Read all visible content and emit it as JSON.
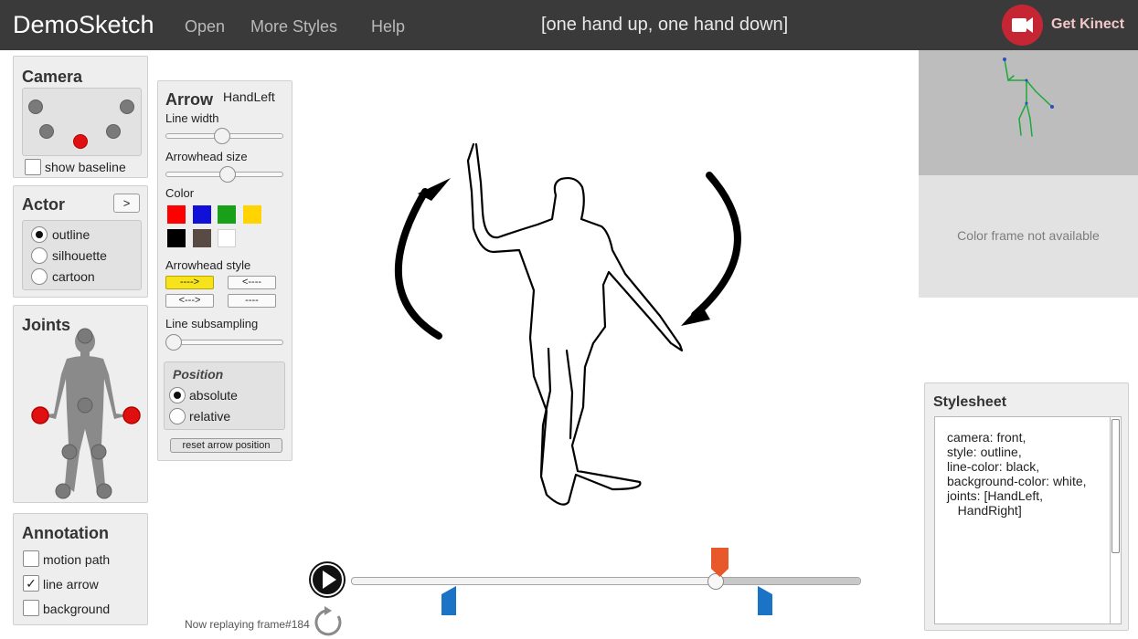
{
  "app": {
    "title": "DemoSketch"
  },
  "nav": {
    "open": "Open",
    "more_styles": "More Styles",
    "help": "Help"
  },
  "pose_label": "[one hand up, one hand down]",
  "kinect": {
    "label": "Get Kinect",
    "color": "#c62634"
  },
  "camera": {
    "title": "Camera",
    "baseline_label": "show baseline",
    "baseline_checked": false
  },
  "actor": {
    "title": "Actor",
    "expand_label": ">",
    "options": [
      "outline",
      "silhouette",
      "cartoon"
    ],
    "selected": "outline"
  },
  "joints": {
    "title": "Joints",
    "selected": [
      "HandLeft",
      "HandRight"
    ]
  },
  "annotation": {
    "title": "Annotation",
    "items": [
      {
        "label": "motion path",
        "checked": false,
        "mark": ""
      },
      {
        "label": "line arrow",
        "checked": true,
        "mark": "✓"
      },
      {
        "label": "background",
        "checked": false,
        "mark": ""
      }
    ]
  },
  "arrow_panel": {
    "title": "Arrow",
    "target": "HandLeft",
    "line_width_label": "Line width",
    "line_width_level": 0.48,
    "arrowhead_size_label": "Arrowhead size",
    "arrowhead_size_level": 0.53,
    "color_label": "Color",
    "colors": [
      "#ff0000",
      "#1010d8",
      "#18a018",
      "#ffd400",
      "#000000",
      "#5a4a44",
      "#ffffff"
    ],
    "arrowhead_style_label": "Arrowhead style",
    "styles": [
      "---->",
      "<----",
      "<--->",
      "----"
    ],
    "selected_style": "---->",
    "subsampling_label": "Line subsampling",
    "subsampling_level": 0.0,
    "position": {
      "title": "Position",
      "options": [
        "absolute",
        "relative"
      ],
      "selected": "absolute"
    },
    "reset_label": "reset arrow position"
  },
  "color_frame": {
    "message": "Color frame not available"
  },
  "stylesheet": {
    "title": "Stylesheet",
    "text": "camera: front,\nstyle: outline,\nline-color: black,\nbackground-color: white,\njoints: [HandLeft,\n   HandRight]"
  },
  "playback": {
    "status": "Now replaying frame#184",
    "current_frame": 184,
    "position": 0.72,
    "marker_color": "#e8582a",
    "range_marker_color": "#1a73c4"
  }
}
